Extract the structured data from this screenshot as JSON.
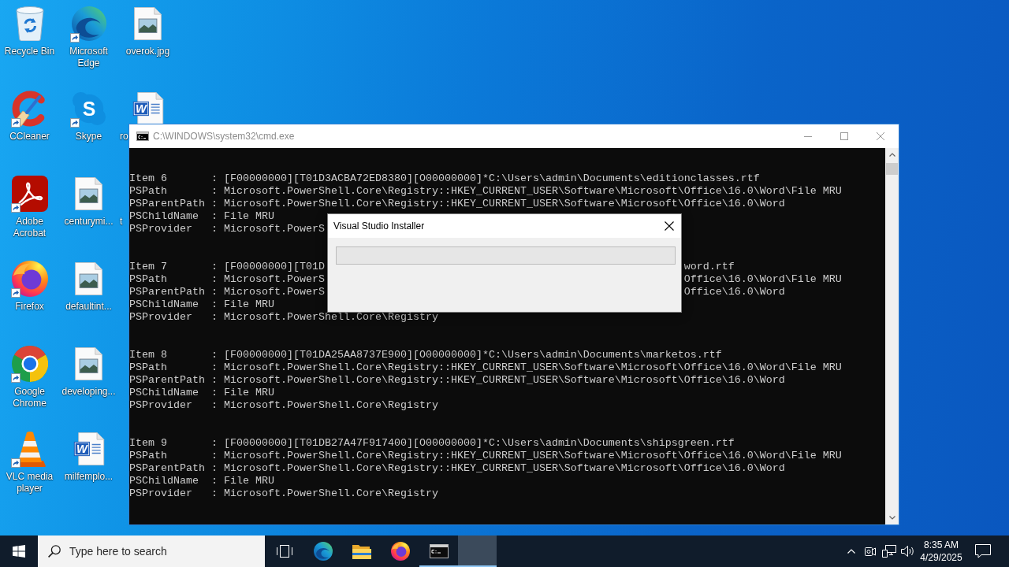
{
  "desktop": {
    "columns": [
      {
        "icons": [
          {
            "label": "Recycle Bin",
            "kind": "recycle",
            "shortcut": false,
            "covered": false
          },
          {
            "label": "CCleaner",
            "kind": "ccleaner",
            "shortcut": true,
            "covered": false
          },
          {
            "label": "Adobe Acrobat",
            "kind": "acrobat",
            "shortcut": true,
            "covered": false
          },
          {
            "label": "Firefox",
            "kind": "firefox",
            "shortcut": true,
            "covered": false
          },
          {
            "label": "Google Chrome",
            "kind": "chrome",
            "shortcut": true,
            "covered": false
          },
          {
            "label": "VLC media player",
            "kind": "vlc",
            "shortcut": true,
            "covered": false
          }
        ]
      },
      {
        "icons": [
          {
            "label": "Microsoft Edge",
            "kind": "edge",
            "shortcut": true,
            "covered": false
          },
          {
            "label": "Skype",
            "kind": "skype",
            "icon_letter": "S",
            "shortcut": true,
            "covered": false
          },
          {
            "label": "centurymi...",
            "kind": "image",
            "shortcut": false,
            "covered": false
          },
          {
            "label": "defaultint...",
            "kind": "image",
            "shortcut": false,
            "covered": false
          },
          {
            "label": "developing...",
            "kind": "image",
            "shortcut": false,
            "covered": false
          },
          {
            "label": "milfemplo...",
            "kind": "word",
            "icon_letter": "W",
            "shortcut": false,
            "covered": false
          }
        ]
      },
      {
        "icons": [
          {
            "label": "overok.jpg",
            "kind": "image",
            "shortcut": false,
            "covered": false
          },
          {
            "label": "ro",
            "kind": "word",
            "icon_letter": "W",
            "shortcut": false,
            "covered": true
          },
          {
            "label": "t",
            "shortcut": false,
            "covered": true
          }
        ]
      }
    ]
  },
  "console_window": {
    "title": "C:\\WINDOWS\\system32\\cmd.exe",
    "active": false,
    "records": [
      {
        "lines": [
          {
            "text": "Item 6       : [F00000000][T01D3ACBA72ED8380][O00000000]*C:\\Users\\admin\\Documents\\editionclasses.rtf"
          },
          {
            "text": "PSPath       : Microsoft.PowerShell.Core\\Registry::HKEY_CURRENT_USER\\Software\\Microsoft\\Office\\16.0\\Word\\File MRU"
          },
          {
            "text": "PSParentPath : Microsoft.PowerShell.Core\\Registry::HKEY_CURRENT_USER\\Software\\Microsoft\\Office\\16.0\\Word"
          },
          {
            "text": "PSChildName  : File MRU"
          },
          {
            "text": "PSProvider   : Microsoft.PowerS"
          }
        ]
      },
      {
        "lines": [
          {
            "text": "Item 7       : [F00000000][T01D",
            "text_right": "word.rtf"
          },
          {
            "text": "PSPath       : Microsoft.PowerS",
            "text_right": "Office\\16.0\\Word\\File MRU"
          },
          {
            "text": "PSParentPath : Microsoft.PowerS",
            "text_right": "Office\\16.0\\Word"
          },
          {
            "text": "PSChildName  : File MRU"
          },
          {
            "text": "PSProvider   : Microsoft.PowerShell.Core\\Registry"
          }
        ]
      },
      {
        "lines": [
          {
            "text": "Item 8       : [F00000000][T01DA25AA8737E900][O00000000]*C:\\Users\\admin\\Documents\\marketos.rtf"
          },
          {
            "text": "PSPath       : Microsoft.PowerShell.Core\\Registry::HKEY_CURRENT_USER\\Software\\Microsoft\\Office\\16.0\\Word\\File MRU"
          },
          {
            "text": "PSParentPath : Microsoft.PowerShell.Core\\Registry::HKEY_CURRENT_USER\\Software\\Microsoft\\Office\\16.0\\Word"
          },
          {
            "text": "PSChildName  : File MRU"
          },
          {
            "text": "PSProvider   : Microsoft.PowerShell.Core\\Registry"
          }
        ]
      },
      {
        "lines": [
          {
            "text": "Item 9       : [F00000000][T01DB27A47F917400][O00000000]*C:\\Users\\admin\\Documents\\shipsgreen.rtf"
          },
          {
            "text": "PSPath       : Microsoft.PowerShell.Core\\Registry::HKEY_CURRENT_USER\\Software\\Microsoft\\Office\\16.0\\Word\\File MRU"
          },
          {
            "text": "PSParentPath : Microsoft.PowerShell.Core\\Registry::HKEY_CURRENT_USER\\Software\\Microsoft\\Office\\16.0\\Word"
          },
          {
            "text": "PSChildName  : File MRU"
          },
          {
            "text": "PSProvider   : Microsoft.PowerShell.Core\\Registry"
          }
        ]
      }
    ]
  },
  "installer_dialog": {
    "title": "Visual Studio Installer",
    "active": true,
    "progress": {
      "level": 0
    }
  },
  "taskbar": {
    "search": {
      "placeholder": "Type here to search"
    },
    "buttons": [
      {
        "kind": "edge",
        "running": false,
        "selected": false
      },
      {
        "kind": "explorer",
        "running": false,
        "selected": false
      },
      {
        "kind": "firefox",
        "running": false,
        "selected": false
      },
      {
        "kind": "console",
        "running": true,
        "selected": false
      },
      {
        "kind": "window",
        "running": true,
        "selected": true
      }
    ],
    "clock": {
      "time": "8:35 AM",
      "date": "4/29/2025"
    }
  }
}
